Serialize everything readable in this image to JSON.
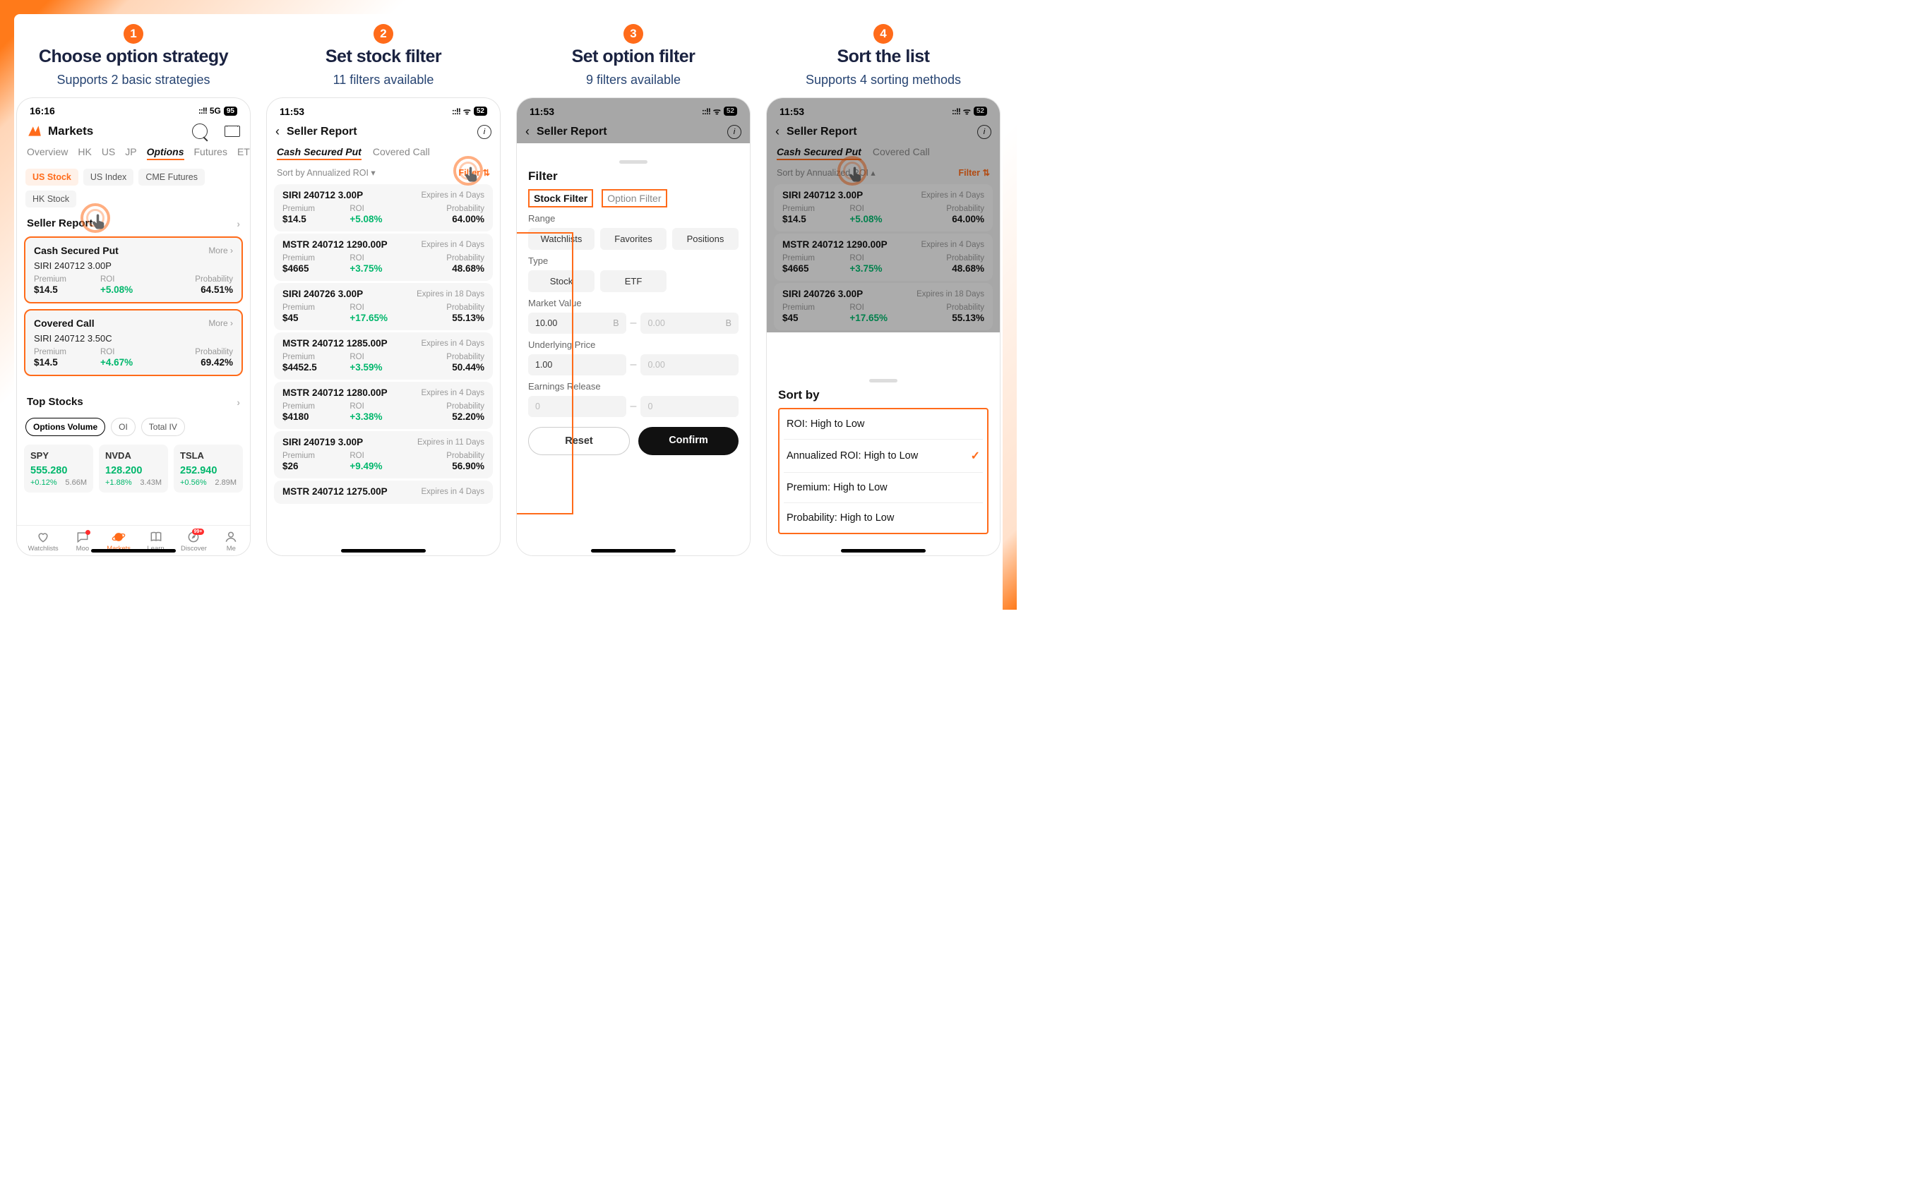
{
  "steps": [
    {
      "num": "1",
      "headline": "Choose option strategy",
      "sub": "Supports 2 basic strategies"
    },
    {
      "num": "2",
      "headline": "Set stock filter",
      "sub": "11 filters available"
    },
    {
      "num": "3",
      "headline": "Set option filter",
      "sub": "9 filters available"
    },
    {
      "num": "4",
      "headline": "Sort  the list",
      "sub": "Supports 4 sorting methods"
    }
  ],
  "p1": {
    "time": "16:16",
    "signal": "5G",
    "battery": "95",
    "markets_title": "Markets",
    "tabs": [
      "Overview",
      "HK",
      "US",
      "JP",
      "Options",
      "Futures",
      "ETF"
    ],
    "active_tab": "Options",
    "chips": [
      "US Stock",
      "US Index",
      "CME Futures",
      "HK Stock"
    ],
    "active_chip": "US Stock",
    "seller_report": "Seller Report",
    "more": "More",
    "cards": [
      {
        "title": "Cash Secured Put",
        "sym": "SIRI 240712 3.00P",
        "premium_lbl": "Premium",
        "premium": "$14.5",
        "roi_lbl": "ROI",
        "roi": "+5.08%",
        "prob_lbl": "Probability",
        "prob": "64.51%"
      },
      {
        "title": "Covered Call",
        "sym": "SIRI 240712 3.50C",
        "premium_lbl": "Premium",
        "premium": "$14.5",
        "roi_lbl": "ROI",
        "roi": "+4.67%",
        "prob_lbl": "Probability",
        "prob": "69.42%"
      }
    ],
    "top_stocks": "Top Stocks",
    "ts_tabs": [
      "Options Volume",
      "OI",
      "Total IV"
    ],
    "stocks": [
      {
        "sym": "SPY",
        "price": "555.280",
        "chg": "+0.12%",
        "vol": "5.66M"
      },
      {
        "sym": "NVDA",
        "price": "128.200",
        "chg": "+1.88%",
        "vol": "3.43M"
      },
      {
        "sym": "TSLA",
        "price": "252.940",
        "chg": "+0.56%",
        "vol": "2.89M"
      }
    ],
    "nav": [
      "Watchlists",
      "Moo",
      "Markets",
      "Learn",
      "Discover",
      "Me"
    ],
    "nav_badge": "99+"
  },
  "p2": {
    "time": "11:53",
    "battery": "52",
    "title": "Seller Report",
    "subtabs": [
      "Cash Secured Put",
      "Covered Call"
    ],
    "sort_label": "Sort by Annualized ROI",
    "filter_label": "Filter",
    "list": [
      {
        "sym": "SIRI 240712 3.00P",
        "exp": "Expires in 4 Days",
        "premium": "$14.5",
        "roi": "+5.08%",
        "prob": "64.00%"
      },
      {
        "sym": "MSTR 240712 1290.00P",
        "exp": "Expires in 4 Days",
        "premium": "$4665",
        "roi": "+3.75%",
        "prob": "48.68%"
      },
      {
        "sym": "SIRI 240726 3.00P",
        "exp": "Expires in 18 Days",
        "premium": "$45",
        "roi": "+17.65%",
        "prob": "55.13%"
      },
      {
        "sym": "MSTR 240712 1285.00P",
        "exp": "Expires in 4 Days",
        "premium": "$4452.5",
        "roi": "+3.59%",
        "prob": "50.44%"
      },
      {
        "sym": "MSTR 240712 1280.00P",
        "exp": "Expires in 4 Days",
        "premium": "$4180",
        "roi": "+3.38%",
        "prob": "52.20%"
      },
      {
        "sym": "SIRI 240719 3.00P",
        "exp": "Expires in 11 Days",
        "premium": "$26",
        "roi": "+9.49%",
        "prob": "56.90%"
      },
      {
        "sym": "MSTR 240712 1275.00P",
        "exp": "Expires in 4 Days",
        "premium": "",
        "roi": "",
        "prob": ""
      }
    ],
    "col_premium": "Premium",
    "col_roi": "ROI",
    "col_prob": "Probability"
  },
  "p3": {
    "time": "11:53",
    "battery": "52",
    "title": "Seller Report",
    "sheet_title": "Filter",
    "tabs": {
      "stock": "Stock Filter",
      "option": "Option Filter"
    },
    "labels": {
      "range": "Range",
      "type": "Type",
      "mv": "Market Value",
      "up": "Underlying Price",
      "er": "Earnings Release"
    },
    "range_opts": [
      "Watchlists",
      "Favorites",
      "Positions"
    ],
    "type_opts": [
      "Stock",
      "ETF"
    ],
    "mv_from": "10.00",
    "mv_unit": "B",
    "mv_to": "0.00",
    "up_from": "1.00",
    "up_to": "0.00",
    "er_from": "0",
    "er_to": "0",
    "reset": "Reset",
    "confirm": "Confirm"
  },
  "p4": {
    "time": "11:53",
    "battery": "52",
    "title": "Seller Report",
    "subtabs": [
      "Cash Secured Put",
      "Covered Call"
    ],
    "sort_label": "Sort by Annualized ROI",
    "filter_label": "Filter",
    "list": [
      {
        "sym": "SIRI 240712 3.00P",
        "exp": "Expires in 4 Days",
        "premium": "$14.5",
        "roi": "+5.08%",
        "prob": "64.00%"
      },
      {
        "sym": "MSTR 240712 1290.00P",
        "exp": "Expires in 4 Days",
        "premium": "$4665",
        "roi": "+3.75%",
        "prob": "48.68%"
      },
      {
        "sym": "SIRI 240726 3.00P",
        "exp": "Expires in 18 Days",
        "premium": "$45",
        "roi": "+17.65%",
        "prob": "55.13%"
      }
    ],
    "sheet_title": "Sort by",
    "options": [
      "ROI: High to Low",
      "Annualized ROI: High to Low",
      "Premium: High to Low",
      "Probability: High to Low"
    ],
    "selected": 1
  }
}
